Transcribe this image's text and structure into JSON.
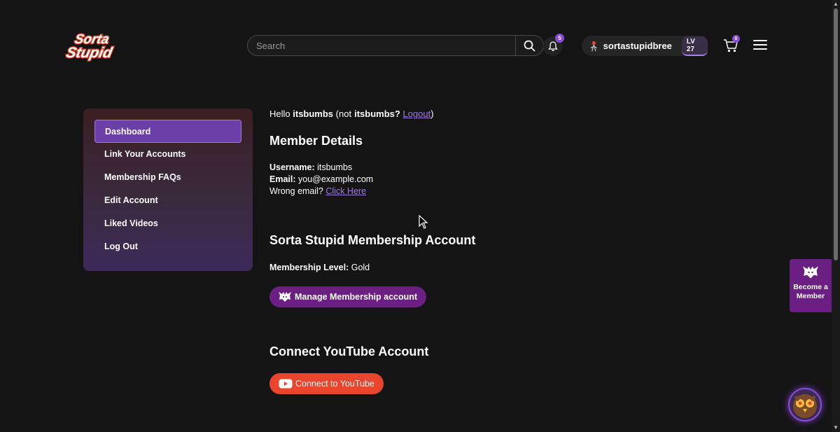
{
  "brand": {
    "logo_text_top": "Sorta",
    "logo_text_bottom": "Stupid"
  },
  "header": {
    "search_placeholder": "Search",
    "notification_count": "5",
    "username": "sortastupidbree",
    "level": "LV 27",
    "cart_count": "0"
  },
  "sidebar": {
    "items": [
      {
        "label": "Dashboard",
        "active": true
      },
      {
        "label": "Link Your Accounts"
      },
      {
        "label": "Membership FAQs"
      },
      {
        "label": "Edit Account"
      },
      {
        "label": "Liked Videos"
      },
      {
        "label": "Log Out"
      }
    ]
  },
  "main": {
    "hello_prefix": "Hello",
    "hello_user": "itsbumbs",
    "hello_not": "(not",
    "hello_user2": "itsbumbs?",
    "logout_link": "Logout",
    "hello_suffix": ")",
    "member_details_title": "Member Details",
    "username_label": "Username:",
    "username_value": "itsbumbs",
    "email_label": "Email:",
    "email_value": "you@example.com",
    "wrong_email_text": "Wrong email?",
    "click_here_link": "Click Here",
    "membership_title": "Sorta Stupid Membership Account",
    "membership_level_label": "Membership Level:",
    "membership_level_value": "Gold",
    "manage_button": "Manage Membership account",
    "youtube_title": "Connect YouTube Account",
    "youtube_button": "Connect to YouTube"
  },
  "become_member": {
    "line1": "Become a",
    "line2": "Member"
  },
  "colors": {
    "background": "#141414",
    "accent_purple": "#6b1f82",
    "link": "#a27ae0",
    "youtube_red": "#e8452c"
  }
}
